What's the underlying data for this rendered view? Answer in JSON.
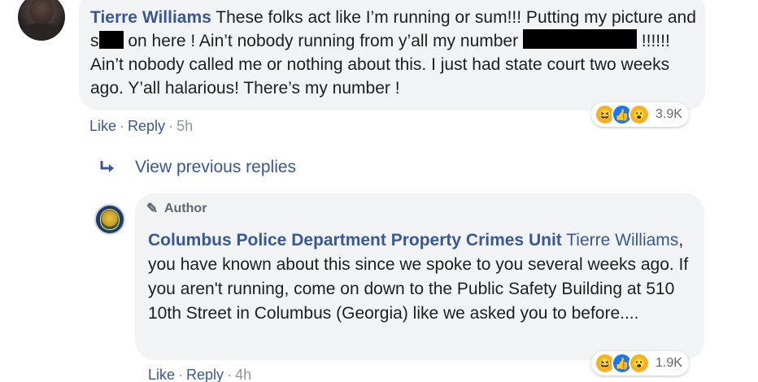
{
  "comment1": {
    "author": "Tierre Williams",
    "text_part1": "These folks act like I’m running or sum!!! Putting my picture and s",
    "text_part2": "on here ! Ain’t nobody running from y’all my number",
    "text_part3": "!!!!!! Ain’t nobody called me or nothing about this. I just had state court two weeks ago. Y’all halarious! There’s my number !",
    "reaction_count": "3.9K",
    "actions": {
      "like": "Like",
      "sep1": "·",
      "reply": "Reply",
      "sep2": "·",
      "time": "5h"
    }
  },
  "view_previous_replies": "View previous replies",
  "comment2": {
    "author_badge": "Author",
    "author": "Columbus Police Department Property Crimes Unit",
    "mention": "Tierre Williams",
    "text": ", you have known about this since we spoke to you several weeks ago. If you aren't running, come on down to the Public Safety Building at 510 10th Street in Columbus (Georgia) like we asked you to before....",
    "reaction_count": "1.9K",
    "actions": {
      "like": "Like",
      "sep1": "·",
      "reply": "Reply",
      "sep2": "·",
      "time": "4h"
    }
  },
  "reaction_icons": [
    "haha-icon",
    "like-icon",
    "wow-icon"
  ],
  "colors": {
    "link_blue": "#385898",
    "bubble_gray": "#f2f3f5",
    "meta_gray": "#90949c",
    "like_blue": "#1877f2",
    "emoji_yellow": "#f7b125"
  }
}
